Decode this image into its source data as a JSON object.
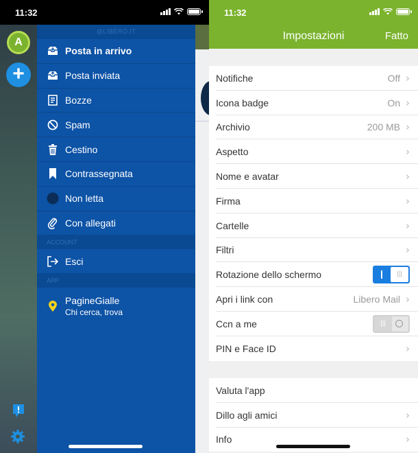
{
  "left": {
    "status_time": "11:32",
    "avatar_letter": "A",
    "drawer_header": "@LIBERO.IT",
    "folders": [
      {
        "label": "Posta in arrivo",
        "icon": "inbox-icon",
        "active": true
      },
      {
        "label": "Posta inviata",
        "icon": "sent-tray-icon"
      },
      {
        "label": "Bozze",
        "icon": "drafts-icon"
      },
      {
        "label": "Spam",
        "icon": "spam-icon"
      },
      {
        "label": "Cestino",
        "icon": "trash-icon"
      },
      {
        "label": "Contrassegnata",
        "icon": "bookmark-icon"
      },
      {
        "label": "Non letta",
        "icon": "unread-dot-icon"
      },
      {
        "label": "Con allegati",
        "icon": "paperclip-icon"
      }
    ],
    "account_section": "ACCOUNT",
    "logout_label": "Esci",
    "app_section": "APP",
    "pagine_title": "PagineGialle",
    "pagine_subtitle": "Chi cerca, trova"
  },
  "right": {
    "status_time": "11:32",
    "nav_title": "Impostazioni",
    "nav_done": "Fatto",
    "settings": [
      {
        "label": "Notifiche",
        "value": "Off",
        "type": "link"
      },
      {
        "label": "Icona badge",
        "value": "On",
        "type": "link"
      },
      {
        "label": "Archivio",
        "value": "200 MB",
        "type": "link"
      },
      {
        "label": "Aspetto",
        "value": "",
        "type": "link"
      },
      {
        "label": "Nome e avatar",
        "value": "",
        "type": "link"
      },
      {
        "label": "Firma",
        "value": "",
        "type": "link"
      },
      {
        "label": "Cartelle",
        "value": "",
        "type": "link"
      },
      {
        "label": "Filtri",
        "value": "",
        "type": "link"
      },
      {
        "label": "Rotazione dello schermo",
        "value": "",
        "type": "toggle",
        "on": true
      },
      {
        "label": "Apri i link con",
        "value": "Libero Mail",
        "type": "link"
      },
      {
        "label": "Ccn a me",
        "value": "",
        "type": "toggle",
        "on": false
      },
      {
        "label": "PIN e Face ID",
        "value": "",
        "type": "link"
      }
    ],
    "extras": [
      {
        "label": "Valuta l'app",
        "chevron": false
      },
      {
        "label": "Dillo agli amici",
        "chevron": true
      },
      {
        "label": "Info",
        "chevron": true
      }
    ]
  },
  "colors": {
    "drawer_blue": "#0d53a6",
    "brand_green": "#7bb32e",
    "toggle_blue": "#1a7ee0"
  }
}
